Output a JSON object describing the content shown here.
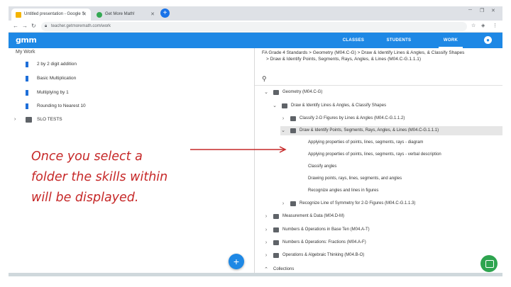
{
  "browser": {
    "tabs": [
      {
        "label": "Untitled presentation - Google S",
        "active": true,
        "fav_color": "#f4b400"
      },
      {
        "label": "Get More Math!",
        "active": false,
        "fav_color": "#34a853"
      }
    ],
    "url": "teacher.getmoremath.com/work"
  },
  "app": {
    "logo": "gmm",
    "nav": [
      {
        "label": "CLASSES",
        "active": false
      },
      {
        "label": "STUDENTS",
        "active": false
      },
      {
        "label": "WORK",
        "active": true
      }
    ],
    "accent": "#1e88e5"
  },
  "left": {
    "title": "My Work",
    "items": [
      {
        "label": "2 by 2 digit addition",
        "type": "skillset"
      },
      {
        "label": "Basic Multiplication",
        "type": "skillset"
      },
      {
        "label": "Multiplying by 1",
        "type": "skillset"
      },
      {
        "label": "Rounding to Nearest 10",
        "type": "skillset"
      },
      {
        "label": "SLO TESTS",
        "type": "folder"
      }
    ]
  },
  "right": {
    "breadcrumb_line1": "FA Grade 4 Standards  >  Geometry (M04.C-G)  >  Draw & Identify Lines & Angles, & Classify Shapes",
    "breadcrumb_line2": ">  Draw & Identify Points, Segments, Rays, Angles, & Lines (M04.C-G.1.1.1)",
    "tree": [
      {
        "label": "Geometry (M04.C-G)",
        "level": 0,
        "caret": "v",
        "kind": "folder",
        "highlight": false
      },
      {
        "label": "Draw & Identify Lines & Angles, & Classify Shapes",
        "level": 1,
        "caret": "v",
        "kind": "folder",
        "highlight": false
      },
      {
        "label": "Classify 2-D Figures by Lines & Angles (M04.C-G.1.1.2)",
        "level": 2,
        "caret": ">",
        "kind": "folder",
        "highlight": false
      },
      {
        "label": "Draw & Identify Points, Segments, Rays, Angles, & Lines (M04.C-G.1.1.1)",
        "level": 2,
        "caret": "v",
        "kind": "folder",
        "highlight": true
      },
      {
        "label": "Applying properties of points, lines, segments, rays - diagram",
        "level": 3,
        "caret": "",
        "kind": "skill",
        "highlight": false
      },
      {
        "label": "Applying properties of points, lines, segments, rays - verbal description",
        "level": 3,
        "caret": "",
        "kind": "skill",
        "highlight": false
      },
      {
        "label": "Classify angles",
        "level": 3,
        "caret": "",
        "kind": "skill",
        "highlight": false
      },
      {
        "label": "Drawing points, rays, lines, segments, and angles",
        "level": 3,
        "caret": "",
        "kind": "skill",
        "highlight": false
      },
      {
        "label": "Recognize angles and lines in figures",
        "level": 3,
        "caret": "",
        "kind": "skill",
        "highlight": false
      },
      {
        "label": "Recognize Line of Symmetry for 2-D Figures (M04.C-G.1.1.3)",
        "level": 2,
        "caret": ">",
        "kind": "folder",
        "highlight": false
      },
      {
        "label": "Measurement & Data (M04.D-M)",
        "level": 0,
        "caret": ">",
        "kind": "folder",
        "highlight": false
      },
      {
        "label": "Numbers & Operations in Base Ten (M04.A-T)",
        "level": 0,
        "caret": ">",
        "kind": "folder",
        "highlight": false
      },
      {
        "label": "Numbers & Operations: Fractions (M04.A-F)",
        "level": 0,
        "caret": ">",
        "kind": "folder",
        "highlight": false
      },
      {
        "label": "Operations & Algebraic Thinking (M04.B-O)",
        "level": 0,
        "caret": ">",
        "kind": "folder",
        "highlight": false
      },
      {
        "label": "Collections",
        "level": 0,
        "caret": "^",
        "kind": "none",
        "highlight": false
      }
    ]
  },
  "annotation": {
    "line1": "Once you select a",
    "line2": "folder the skills within",
    "line3": "will be displayed.",
    "color": "#c62828"
  }
}
